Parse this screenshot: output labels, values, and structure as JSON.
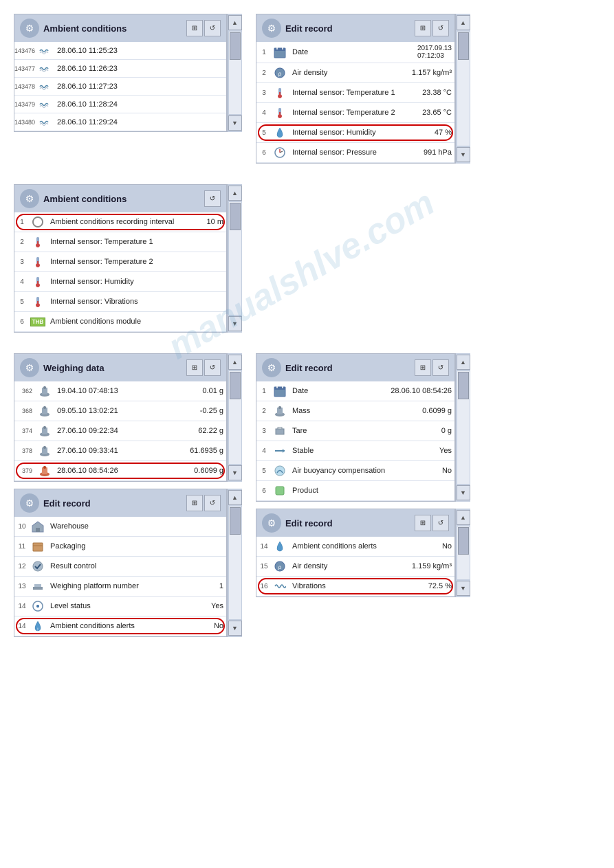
{
  "top_left_panel": {
    "title": "Ambient conditions",
    "records": [
      {
        "id": "143476",
        "datetime": "28.06.10 11:25:23"
      },
      {
        "id": "143477",
        "datetime": "28.06.10 11:26:23"
      },
      {
        "id": "143478",
        "datetime": "28.06.10 11:27:23"
      },
      {
        "id": "143479",
        "datetime": "28.06.10 11:28:24"
      },
      {
        "id": "143480",
        "datetime": "28.06.10 11:29:24"
      }
    ]
  },
  "top_right_panel": {
    "title": "Edit record",
    "rows": [
      {
        "num": "1",
        "label": "Date",
        "value": "2017.09.13\n07:12:03",
        "icon": "calendar"
      },
      {
        "num": "2",
        "label": "Air density",
        "value": "1.157 kg/m³",
        "icon": "airdensity"
      },
      {
        "num": "3",
        "label": "Internal sensor: Temperature 1",
        "value": "23.38 °C",
        "icon": "thermo"
      },
      {
        "num": "4",
        "label": "Internal sensor: Temperature 2",
        "value": "23.65 °C",
        "icon": "thermo"
      },
      {
        "num": "5",
        "label": "Internal sensor: Humidity",
        "value": "47 %",
        "icon": "humidity",
        "highlight": true
      },
      {
        "num": "6",
        "label": "Internal sensor: Pressure",
        "value": "991 hPa",
        "icon": "pressure"
      }
    ]
  },
  "middle_panel": {
    "title": "Ambient conditions",
    "rows": [
      {
        "num": "1",
        "label": "Ambient conditions recording interval",
        "value": "10 m",
        "icon": "circle",
        "highlight": true
      },
      {
        "num": "2",
        "label": "Internal sensor: Temperature 1",
        "value": "",
        "icon": "thermo"
      },
      {
        "num": "3",
        "label": "Internal sensor: Temperature 2",
        "value": "",
        "icon": "thermo"
      },
      {
        "num": "4",
        "label": "Internal sensor: Humidity",
        "value": "",
        "icon": "thermo"
      },
      {
        "num": "5",
        "label": "Internal sensor: Vibrations",
        "value": "",
        "icon": "thermo"
      },
      {
        "num": "6",
        "label": "Ambient conditions module",
        "value": "",
        "icon": "thb"
      }
    ]
  },
  "bottom_left_weighing": {
    "title": "Weighing data",
    "records": [
      {
        "id": "362",
        "datetime": "19.04.10 07:48:13",
        "value": "0.01 g"
      },
      {
        "id": "368",
        "datetime": "09.05.10 13:02:21",
        "value": "-0.25 g"
      },
      {
        "id": "374",
        "datetime": "27.06.10 09:22:34",
        "value": "62.22 g"
      },
      {
        "id": "378",
        "datetime": "27.06.10 09:33:41",
        "value": "61.6935 g"
      },
      {
        "id": "379",
        "datetime": "28.06.10 08:54:26",
        "value": "0.6099 g",
        "highlight": true
      }
    ]
  },
  "bottom_left_edit1": {
    "title": "Edit record",
    "rows": [
      {
        "num": "10",
        "label": "Warehouse",
        "value": "",
        "icon": "warehouse"
      },
      {
        "num": "11",
        "label": "Packaging",
        "value": "",
        "icon": "packaging"
      },
      {
        "num": "12",
        "label": "Result control",
        "value": "",
        "icon": "result"
      },
      {
        "num": "13",
        "label": "Weighing platform number",
        "value": "1",
        "icon": "platform"
      },
      {
        "num": "14",
        "label": "Level status",
        "value": "Yes",
        "icon": "level"
      },
      {
        "num": "14",
        "label": "Ambient conditions alerts",
        "value": "No",
        "icon": "alerts",
        "highlight": true
      }
    ]
  },
  "bottom_right_edit1": {
    "title": "Edit record",
    "rows": [
      {
        "num": "1",
        "label": "Date",
        "value": "28.06.10 08:54:26",
        "icon": "calendar"
      },
      {
        "num": "2",
        "label": "Mass",
        "value": "0.6099 g",
        "icon": "weight"
      },
      {
        "num": "3",
        "label": "Tare",
        "value": "0 g",
        "icon": "tare"
      },
      {
        "num": "4",
        "label": "Stable",
        "value": "Yes",
        "icon": "stable"
      },
      {
        "num": "5",
        "label": "Air buoyancy compensation",
        "value": "No",
        "icon": "air"
      },
      {
        "num": "6",
        "label": "Product",
        "value": "",
        "icon": "product"
      }
    ]
  },
  "bottom_right_edit2": {
    "title": "Edit record",
    "rows": [
      {
        "num": "14",
        "label": "Ambient conditions alerts",
        "value": "No",
        "icon": "alerts"
      },
      {
        "num": "15",
        "label": "Air density",
        "value": "1.159 kg/m³",
        "icon": "airdensity"
      },
      {
        "num": "16",
        "label": "Vibrations",
        "value": "72.5 %",
        "icon": "vibrations",
        "highlight": true
      }
    ]
  },
  "watermark": "manualshlve.com"
}
